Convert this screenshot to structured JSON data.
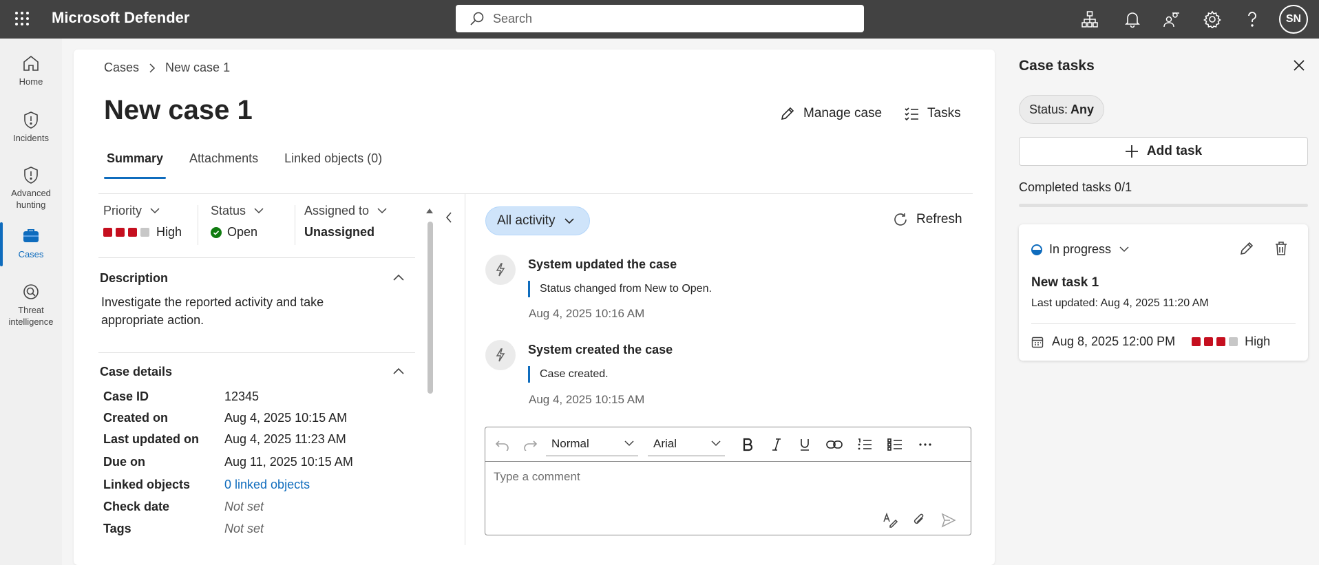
{
  "topbar": {
    "app_title": "Microsoft Defender",
    "search_placeholder": "Search",
    "avatar_initials": "SN",
    "icons": [
      "waffle-icon",
      "org-chart-icon",
      "bell-icon",
      "people-icon",
      "gear-icon",
      "help-icon"
    ]
  },
  "nav": {
    "items": [
      {
        "label": "Home",
        "icon": "home-icon"
      },
      {
        "label": "Incidents",
        "icon": "shield-alert-icon"
      },
      {
        "label": "Advanced hunting",
        "icon": "shield-hunting-icon"
      },
      {
        "label": "Cases",
        "icon": "briefcase-icon",
        "active": true
      },
      {
        "label": "Threat intelligence",
        "icon": "threat-intel-icon"
      }
    ]
  },
  "breadcrumb": {
    "parent": "Cases",
    "current": "New case 1"
  },
  "page": {
    "title": "New case 1",
    "manage_case": "Manage case",
    "tasks": "Tasks"
  },
  "tabs": [
    {
      "label": "Summary",
      "active": true
    },
    {
      "label": "Attachments"
    },
    {
      "label": "Linked objects (0)"
    }
  ],
  "properties": {
    "priority": {
      "label": "Priority",
      "value": "High",
      "level": 3,
      "max": 4,
      "color": "#c50f1f"
    },
    "status": {
      "label": "Status",
      "value": "Open",
      "color": "#107c10"
    },
    "assigned": {
      "label": "Assigned to",
      "value": "Unassigned"
    }
  },
  "description": {
    "title": "Description",
    "text": "Investigate the reported activity and take appropriate action."
  },
  "case_details": {
    "title": "Case details",
    "rows": [
      {
        "key": "Case ID",
        "value": "12345"
      },
      {
        "key": "Created on",
        "value": "Aug 4, 2025 10:15 AM"
      },
      {
        "key": "Last updated on",
        "value": "Aug 4, 2025 11:23 AM"
      },
      {
        "key": "Due on",
        "value": "Aug 11, 2025 10:15 AM"
      },
      {
        "key": "Linked objects",
        "value": "0 linked objects"
      },
      {
        "key": "Check date",
        "value": "Not set"
      },
      {
        "key": "Tags",
        "value": "Not set"
      }
    ]
  },
  "activity": {
    "filter": "All activity",
    "refresh": "Refresh",
    "items": [
      {
        "title": "System updated the case",
        "detail": "Status changed from New to Open.",
        "time": "Aug 4, 2025 10:16 AM"
      },
      {
        "title": "System created the case",
        "detail": "Case created.",
        "time": "Aug 4, 2025 10:15 AM"
      }
    ]
  },
  "editor": {
    "style": "Normal",
    "font": "Arial",
    "placeholder": "Type a comment"
  },
  "case_tasks": {
    "title": "Case tasks",
    "status_filter_label": "Status:",
    "status_filter_value": "Any",
    "add_task": "Add task",
    "completed": "Completed tasks 0/1",
    "completed_fraction": 0,
    "task": {
      "status": "In progress",
      "name": "New task 1",
      "last_updated": "Last updated: Aug 4, 2025 11:20 AM",
      "due": "Aug 8, 2025 12:00 PM",
      "priority": "High",
      "priority_level": 3
    }
  },
  "colors": {
    "accent": "#0f6cbd",
    "danger": "#c50f1f",
    "success": "#107c10",
    "topbar": "#424242"
  }
}
